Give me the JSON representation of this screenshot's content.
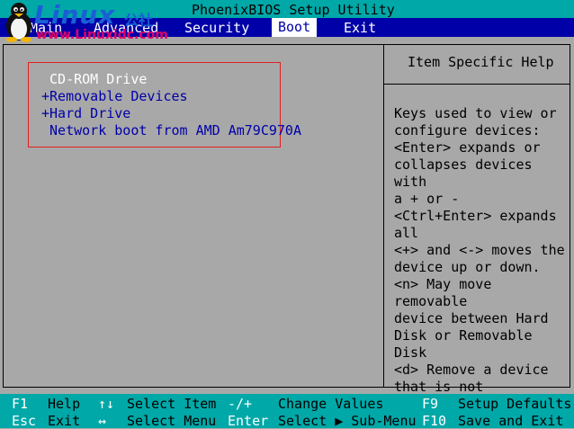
{
  "title": "PhoenixBIOS Setup Utility",
  "menu": [
    {
      "label": "Main"
    },
    {
      "label": "Advanced"
    },
    {
      "label": "Security"
    },
    {
      "label": "Boot"
    },
    {
      "label": "Exit"
    }
  ],
  "watermark": {
    "brand": "Linux",
    "brand_cn": "公社",
    "url": "www.Linuxidc.com"
  },
  "boot_items": [
    {
      "label": " CD-ROM Drive"
    },
    {
      "label": "+Removable Devices"
    },
    {
      "label": "+Hard Drive"
    },
    {
      "label": " Network boot from AMD Am79C970A"
    }
  ],
  "help": {
    "title": "Item Specific Help",
    "text": "Keys used to view or\nconfigure devices:\n<Enter> expands or\ncollapses devices with\na + or -\n<Ctrl+Enter> expands\nall\n<+> and <-> moves the\ndevice up or down.\n<n> May move removable\ndevice between Hard\nDisk or Removable Disk\n<d> Remove a device\nthat is not installed."
  },
  "footer": {
    "row1": [
      {
        "key": "F1",
        "desc": "Help"
      },
      {
        "key": "↑↓",
        "desc": "Select Item"
      },
      {
        "key": "-/+",
        "desc": "Change Values"
      },
      {
        "key": "F9",
        "desc": "Setup Defaults"
      }
    ],
    "row2": [
      {
        "key": "Esc",
        "desc": "Exit"
      },
      {
        "key": "↔",
        "desc": "Select Menu"
      },
      {
        "key": "Enter",
        "desc": "Select ▶ Sub-Menu"
      },
      {
        "key": "F10",
        "desc": "Save and Exit"
      }
    ]
  },
  "colors": {
    "title_bar": "#00a8a8",
    "menu_bar": "#0000a8",
    "panel_bg": "#a8a8a8",
    "item_text": "#0000a8",
    "selected_text": "#ffffff",
    "highlight_border": "#e02020"
  }
}
